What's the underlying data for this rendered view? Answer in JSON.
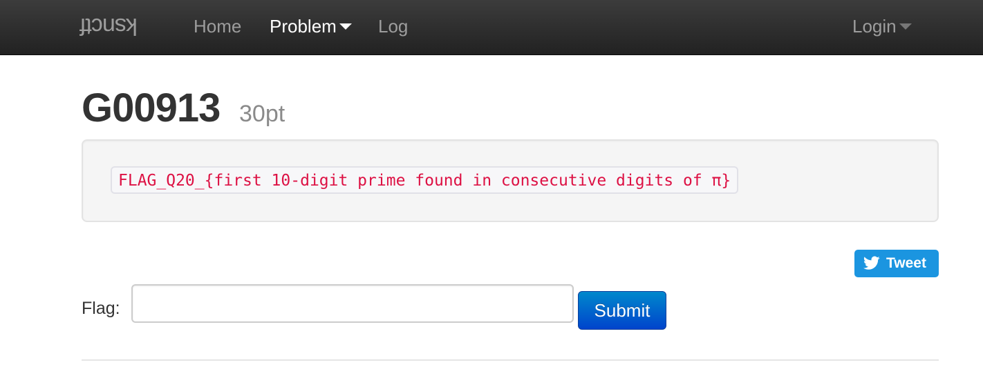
{
  "navbar": {
    "brand": "ksnctf",
    "items": [
      {
        "label": "Home"
      },
      {
        "label": "Problem"
      },
      {
        "label": "Log"
      }
    ],
    "login_label": "Login"
  },
  "problem": {
    "title": "G00913",
    "points": "30pt",
    "statement": "FLAG_Q20_{first 10-digit prime found in consecutive digits of π}"
  },
  "tweet": {
    "label": "Tweet",
    "icon": "twitter-bird-icon"
  },
  "form": {
    "flag_label": "Flag:",
    "flag_value": "",
    "flag_placeholder": "",
    "submit_label": "Submit"
  },
  "colors": {
    "navbar_bg": "#222222",
    "nav_text": "#9d9d9d",
    "nav_active_text": "#ffffff",
    "code_text": "#dd1144",
    "tweet_bg": "#1b95e0",
    "submit_bg": "#0055cc"
  }
}
